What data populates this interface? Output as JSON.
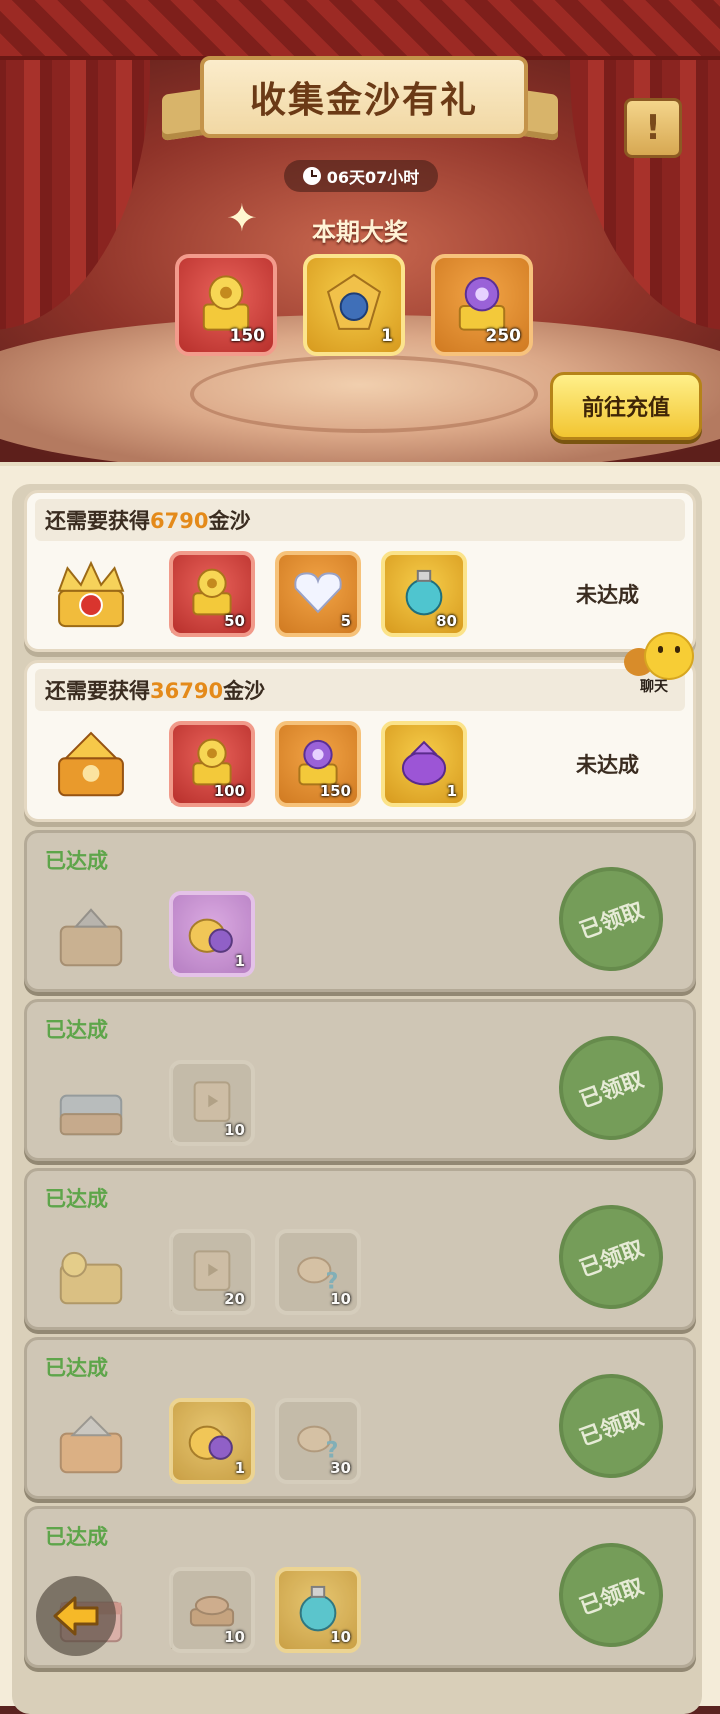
{
  "header": {
    "title": "收集金沙有礼",
    "timer": "06天07小时",
    "grand_prize_label": "本期大奖",
    "grand_prizes": [
      {
        "icon": "golden-dragon-chest-icon",
        "count": "150",
        "frame": "red"
      },
      {
        "icon": "blue-dragon-pet-icon",
        "count": "1",
        "frame": "gold"
      },
      {
        "icon": "purple-crystal-chest-icon",
        "count": "250",
        "frame": "orange"
      }
    ],
    "recharge_label": "前往充值",
    "info_label": "!"
  },
  "chat": {
    "label": "聊天"
  },
  "tiers": [
    {
      "prefix": "还需要获得",
      "amount": "6790",
      "suffix": "金沙",
      "status": "未达成",
      "state": "active",
      "chest_icon": "red-gold-crown-chest-icon",
      "items": [
        {
          "icon": "golden-dragon-chest-icon",
          "qty": "50",
          "frame": "red"
        },
        {
          "icon": "diamond-heart-icon",
          "qty": "5",
          "frame": "orange"
        },
        {
          "icon": "blue-potion-icon",
          "qty": "80",
          "frame": "gold"
        }
      ]
    },
    {
      "prefix": "还需要获得",
      "amount": "36790",
      "suffix": "金沙",
      "status": "未达成",
      "state": "active",
      "chest_icon": "orange-leaf-chest-icon",
      "items": [
        {
          "icon": "golden-dragon-chest-icon",
          "qty": "100",
          "frame": "red"
        },
        {
          "icon": "purple-crystal-chest-icon",
          "qty": "150",
          "frame": "orange"
        },
        {
          "icon": "purple-loot-bag-icon",
          "qty": "1",
          "frame": "gold"
        }
      ]
    },
    {
      "label": "已达成",
      "stamp": "已领取",
      "state": "done",
      "chest_icon": "wooden-chest-icon",
      "items": [
        {
          "icon": "gold-coin-bag-icon",
          "qty": "1",
          "frame": "purple"
        }
      ]
    },
    {
      "label": "已达成",
      "stamp": "已领取",
      "state": "done",
      "chest_icon": "steel-chest-icon",
      "items": [
        {
          "icon": "video-ticket-icon",
          "qty": "10",
          "frame": "gray"
        }
      ]
    },
    {
      "label": "已达成",
      "stamp": "已领取",
      "state": "done",
      "chest_icon": "golden-chest-icon",
      "items": [
        {
          "icon": "video-ticket-icon",
          "qty": "20",
          "frame": "gray"
        },
        {
          "icon": "mystery-meat-icon",
          "qty": "10",
          "frame": "gray"
        }
      ]
    },
    {
      "label": "已达成",
      "stamp": "已领取",
      "state": "done",
      "chest_icon": "silver-orange-chest-icon",
      "items": [
        {
          "icon": "gold-coin-bag-icon",
          "qty": "1",
          "frame": "goldDim"
        },
        {
          "icon": "mystery-meat-icon",
          "qty": "30",
          "frame": "gray"
        }
      ]
    },
    {
      "label": "已达成",
      "stamp": "已领取",
      "state": "done",
      "chest_icon": "pink-chest-icon",
      "items": [
        {
          "icon": "roast-meal-icon",
          "qty": "10",
          "frame": "gray"
        },
        {
          "icon": "blue-potion-icon",
          "qty": "10",
          "frame": "goldDim"
        }
      ]
    }
  ],
  "colors": {
    "accent_orange": "#e48a1a",
    "done_green": "#5ea54a",
    "stamp_green": "#6e9a52"
  }
}
